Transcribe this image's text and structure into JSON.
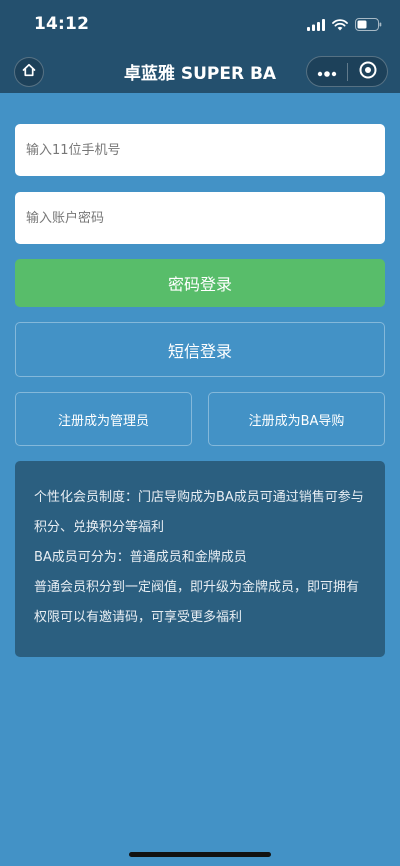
{
  "status_bar": {
    "time": "14:12"
  },
  "nav": {
    "title": "卓蓝雅 SUPER BA"
  },
  "form": {
    "phone_placeholder": "输入11位手机号",
    "password_placeholder": "输入账户密码"
  },
  "buttons": {
    "password_login": "密码登录",
    "sms_login": "短信登录",
    "register_admin": "注册成为管理员",
    "register_ba": "注册成为BA导购"
  },
  "info": {
    "paragraphs": [
      "个性化会员制度：门店导购成为BA成员可通过销售可参与积分、兑换积分等福利",
      " BA成员可分为：普通成员和金牌成员",
      " 普通会员积分到一定阀值，即升级为金牌成员，即可拥有权限可以有邀请码，可享受更多福利"
    ]
  },
  "colors": {
    "header": "#24506e",
    "background": "#4392c6",
    "primary_button": "#58bd6a",
    "info_box": "#2b5f80"
  },
  "icons": {
    "home": "home-icon",
    "more": "more-dots-icon",
    "close": "target-circle-icon",
    "signal": "signal-icon",
    "wifi": "wifi-icon",
    "battery": "battery-icon"
  }
}
